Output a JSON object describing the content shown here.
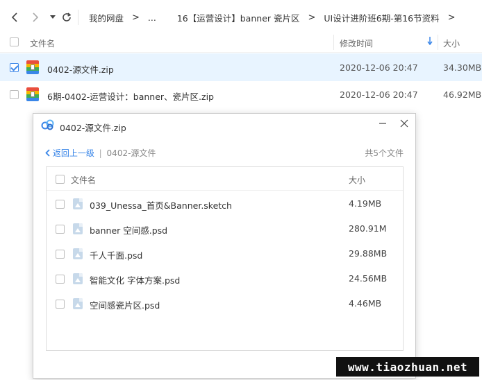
{
  "nav": {
    "breadcrumb": [
      "我的网盘",
      "...",
      "16【运营设计】banner 瓷片区",
      "UI设计进阶班6期-第16节资料"
    ],
    "separator": ">"
  },
  "list": {
    "columns": {
      "name": "文件名",
      "modified": "修改时间",
      "size": "大小"
    },
    "rows": [
      {
        "name": "0402-源文件.zip",
        "modified": "2020-12-06 20:47",
        "size": "34.30MB",
        "selected": true
      },
      {
        "name": "6期-0402-运营设计：banner、瓷片区.zip",
        "modified": "2020-12-06 20:47",
        "size": "46.92MB",
        "selected": false
      }
    ]
  },
  "dialog": {
    "title": "0402-源文件.zip",
    "back_label": "返回上一级",
    "divider": "|",
    "current_folder": "0402-源文件",
    "count_text": "共5个文件",
    "columns": {
      "name": "文件名",
      "size": "大小"
    },
    "files": [
      {
        "name": "039_Unessa_首页&Banner.sketch",
        "size": "4.19MB"
      },
      {
        "name": "banner 空间感.psd",
        "size": "280.91M"
      },
      {
        "name": "千人千面.psd",
        "size": "29.88MB"
      },
      {
        "name": "智能文化 字体方案.psd",
        "size": "24.56MB"
      },
      {
        "name": "空间感瓷片区.psd",
        "size": "4.46MB"
      }
    ]
  },
  "watermark": "www.tiaozhuan.net",
  "colors": {
    "accent": "#3a86e8",
    "selected_row": "#e8f4ff"
  }
}
